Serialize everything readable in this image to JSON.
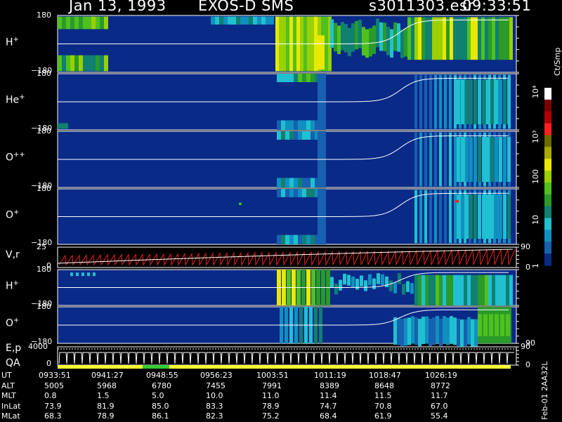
{
  "header": {
    "date": "Jan 13, 1993",
    "instrument": "EXOS-D SMS",
    "file": "s3011303.esr",
    "time": "09:33:51"
  },
  "colors": {
    "background": "#000000",
    "plot_bg": "#0a2a88",
    "trace_white": "#ffffff",
    "trace_red": "#e8241c",
    "qa_yellow": "#ffff33",
    "qa_green": "#33cc33"
  },
  "panels": [
    {
      "id": "h-plus-1",
      "label": "H",
      "sup": "+",
      "y_top": "180",
      "y_bottom": "−180"
    },
    {
      "id": "he-plus",
      "label": "He",
      "sup": "+",
      "y_top": "180",
      "y_bottom": "−180"
    },
    {
      "id": "o-plusplus",
      "label": "O",
      "sup": "++",
      "y_top": "180",
      "y_bottom": "−180"
    },
    {
      "id": "o-plus-1",
      "label": "O",
      "sup": "+",
      "y_top": "180",
      "y_bottom": "−180"
    },
    {
      "id": "v-r",
      "label": "V,r",
      "sup": "",
      "y_top": "25",
      "y_bottom": "0",
      "right_top": "90",
      "right_bottom": "0"
    },
    {
      "id": "h-plus-2",
      "label": "H",
      "sup": "+",
      "y_top": "180",
      "y_bottom": "−180"
    },
    {
      "id": "o-plus-2",
      "label": "O",
      "sup": "+",
      "y_top": "180",
      "y_bottom": "−180",
      "right_bottom": "90"
    },
    {
      "id": "e-p-qa",
      "label": "E,p",
      "label2": "QA",
      "sup": "",
      "y_top": "4000",
      "y_bottom": "0",
      "right_top": "90",
      "right_bottom": "0"
    }
  ],
  "colorbar": {
    "unit": "Ct/Smp",
    "labels": [
      "10⁴",
      "10³",
      "100",
      "10",
      "1"
    ],
    "colors": [
      "#ffffff",
      "#7a0000",
      "#b00000",
      "#ff2020",
      "#6b6b00",
      "#a8a800",
      "#e8e800",
      "#9ad000",
      "#50c020",
      "#2a9a2a",
      "#108070",
      "#20c0d0",
      "#1090c0",
      "#1860b0",
      "#0a2a88"
    ]
  },
  "side_label": "Feb-01 2AA32L",
  "table": {
    "row_labels": [
      "UT",
      "ALT",
      "MLT",
      "InLat",
      "MLat"
    ],
    "columns": [
      {
        "UT": "0933:51",
        "ALT": "5005",
        "MLT": "0.8",
        "InLat": "73.9",
        "MLat": "68.3"
      },
      {
        "UT": "0941:27",
        "ALT": "5968",
        "MLT": "1.5",
        "InLat": "81.9",
        "MLat": "78.9"
      },
      {
        "UT": "0948:55",
        "ALT": "6780",
        "MLT": "5.0",
        "InLat": "85.0",
        "MLat": "86.1"
      },
      {
        "UT": "0956:23",
        "ALT": "7455",
        "MLT": "10.0",
        "InLat": "83.3",
        "MLat": "82.3"
      },
      {
        "UT": "1003:51",
        "ALT": "7991",
        "MLT": "11.0",
        "InLat": "78.9",
        "MLat": "75.2"
      },
      {
        "UT": "1011:19",
        "ALT": "8389",
        "MLT": "11.4",
        "InLat": "74.7",
        "MLat": "68.4"
      },
      {
        "UT": "1018:47",
        "ALT": "8648",
        "MLT": "11.5",
        "InLat": "70.8",
        "MLat": "61.9"
      },
      {
        "UT": "1026:19",
        "ALT": "8772",
        "MLT": "11.7",
        "InLat": "67.0",
        "MLat": "55.4"
      }
    ]
  },
  "chart_data": {
    "type": "heatmap",
    "title": "Jan 13, 1993 EXOS-D SMS",
    "xlabel": "UT",
    "x_ticks": [
      "0933:51",
      "0941:27",
      "0948:55",
      "0956:23",
      "1003:51",
      "1011:19",
      "1018:47",
      "1026:19"
    ],
    "ion_panels": [
      {
        "name": "H+",
        "ylim": [
          -180,
          180
        ]
      },
      {
        "name": "He+",
        "ylim": [
          -180,
          180
        ]
      },
      {
        "name": "O++",
        "ylim": [
          -180,
          180
        ]
      },
      {
        "name": "O+",
        "ylim": [
          -180,
          180
        ]
      },
      {
        "name": "H+",
        "ylim": [
          -180,
          180
        ]
      },
      {
        "name": "O+",
        "ylim": [
          -180,
          180
        ]
      }
    ],
    "vr_panel": {
      "name": "V,r",
      "ylim": [
        0,
        25
      ],
      "right_axis": [
        0,
        90
      ]
    },
    "ep_panel": {
      "name": "E,p",
      "ylim": [
        0,
        4000
      ],
      "right_axis": [
        0,
        90
      ]
    },
    "colorbar": {
      "unit": "Ct/Smp",
      "scale": "log",
      "range": [
        1,
        10000
      ]
    }
  }
}
